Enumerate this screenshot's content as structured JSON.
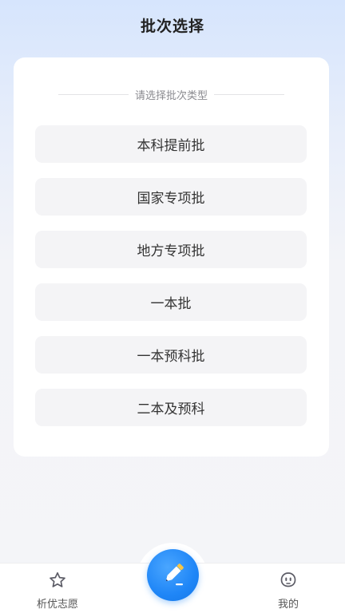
{
  "header": {
    "title": "批次选择"
  },
  "card": {
    "prompt": "请选择批次类型",
    "options": [
      {
        "label": "本科提前批"
      },
      {
        "label": "国家专项批"
      },
      {
        "label": "地方专项批"
      },
      {
        "label": "一本批"
      },
      {
        "label": "一本预科批"
      },
      {
        "label": "二本及预科"
      }
    ]
  },
  "tabbar": {
    "left": {
      "label": "析优志愿",
      "icon": "star-icon"
    },
    "center": {
      "icon": "pencil-icon"
    },
    "right": {
      "label": "我的",
      "icon": "robot-face-icon"
    }
  },
  "colors": {
    "accent": "#1f86f7",
    "pencil_tip": "#f7c544"
  }
}
